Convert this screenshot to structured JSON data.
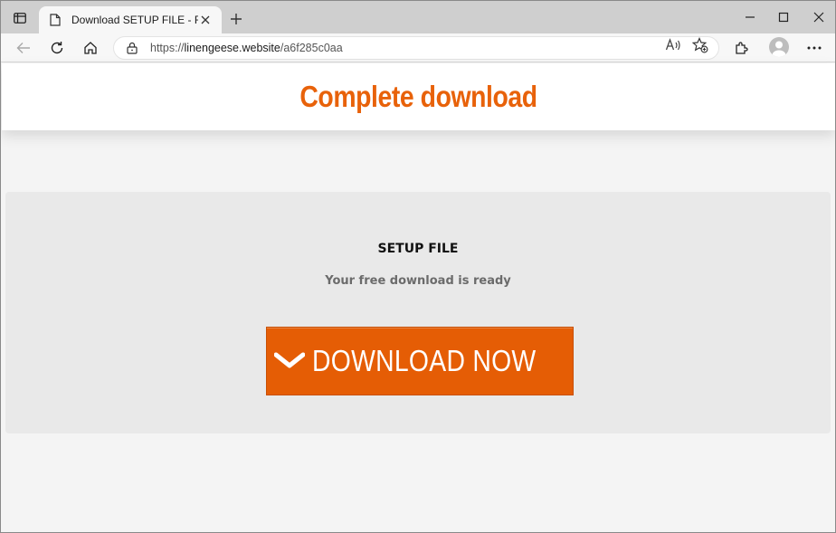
{
  "browser": {
    "tab_title": "Download SETUP FILE - Free",
    "url_scheme": "https://",
    "url_host": "linengeese.website",
    "url_path": "/a6f285c0aa"
  },
  "page": {
    "header_title": "Complete download",
    "file_title": "SETUP FILE",
    "subtitle": "Your free download is ready",
    "download_button_label": "DOWNLOAD NOW"
  },
  "colors": {
    "accent": "#e8620a",
    "button": "#e55d05"
  },
  "icons": [
    "sidebar-icon",
    "page-icon",
    "close-icon",
    "plus-icon",
    "minimize-icon",
    "maximize-icon",
    "back-icon",
    "reload-icon",
    "home-icon",
    "lock-icon",
    "read-aloud-icon",
    "favorite-icon",
    "extensions-icon",
    "profile-icon",
    "more-icon",
    "chevron-down-icon"
  ]
}
